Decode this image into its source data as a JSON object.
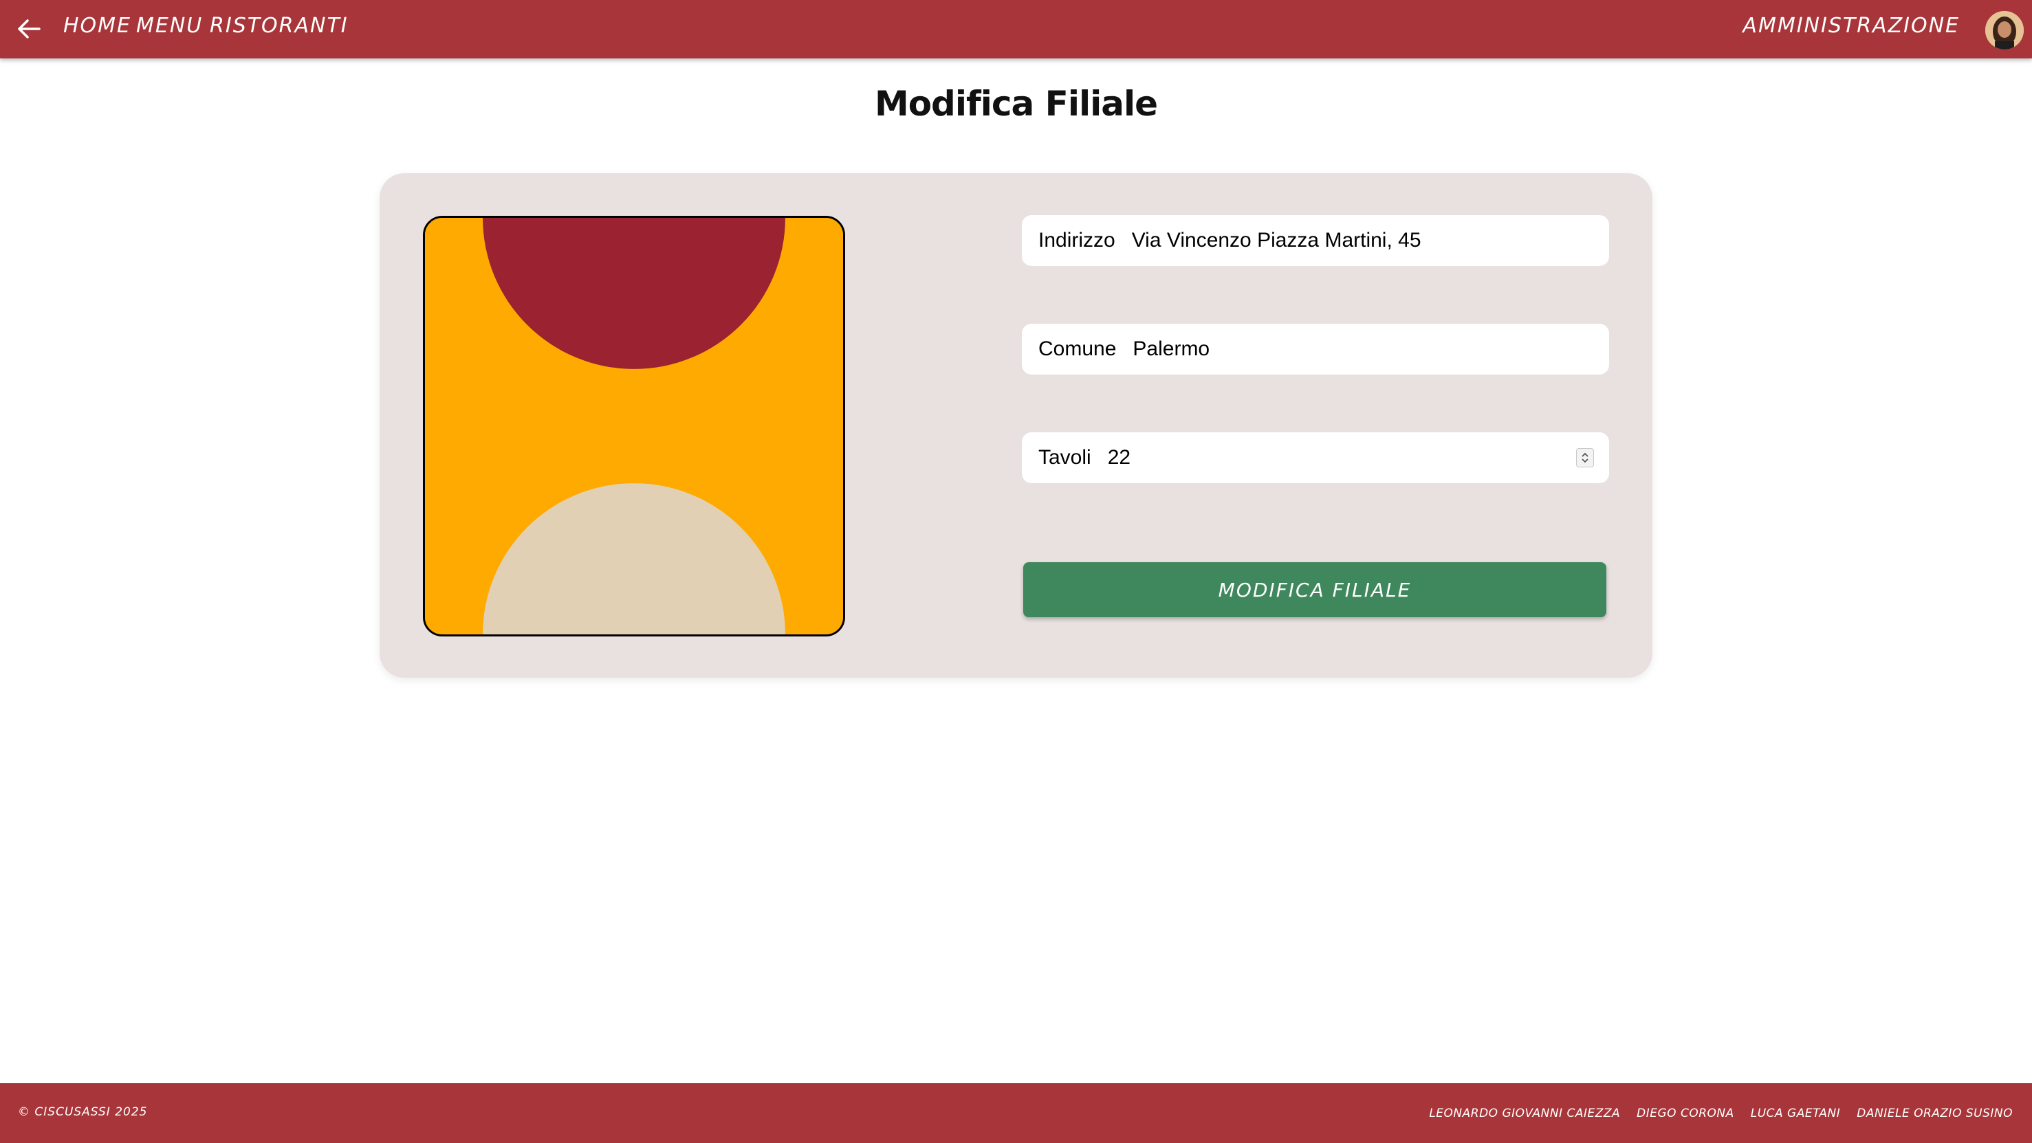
{
  "header": {
    "nav": {
      "home": "HOME",
      "menu": "MENU",
      "ristoranti": "RISTORANTI",
      "admin": "AMMINISTRAZIONE"
    },
    "back_icon": "arrow-left-icon",
    "avatar_icon": "user-avatar"
  },
  "page": {
    "title": "Modifica Filiale"
  },
  "form": {
    "image": {
      "background_color": "#ffaa00",
      "top_shape_color": "#9b2230",
      "bottom_shape_color": "#e2d0b5"
    },
    "address": {
      "label": "Indirizzo",
      "value": "Via Vincenzo Piazza Martini, 45"
    },
    "city": {
      "label": "Comune",
      "value": "Palermo"
    },
    "tables": {
      "label": "Tavoli",
      "value": "22"
    },
    "submit_label": "MODIFICA FILIALE"
  },
  "footer": {
    "copyright": "© CISCUSASSI 2025",
    "authors": [
      "LEONARDO GIOVANNI CAIEZZA",
      "DIEGO CORONA",
      "LUCA GAETANI",
      "DANIELE ORAZIO SUSINO"
    ]
  },
  "colors": {
    "brand": "#a83539",
    "accent_button": "#3f875c",
    "card_bg": "#e8e1e0"
  }
}
